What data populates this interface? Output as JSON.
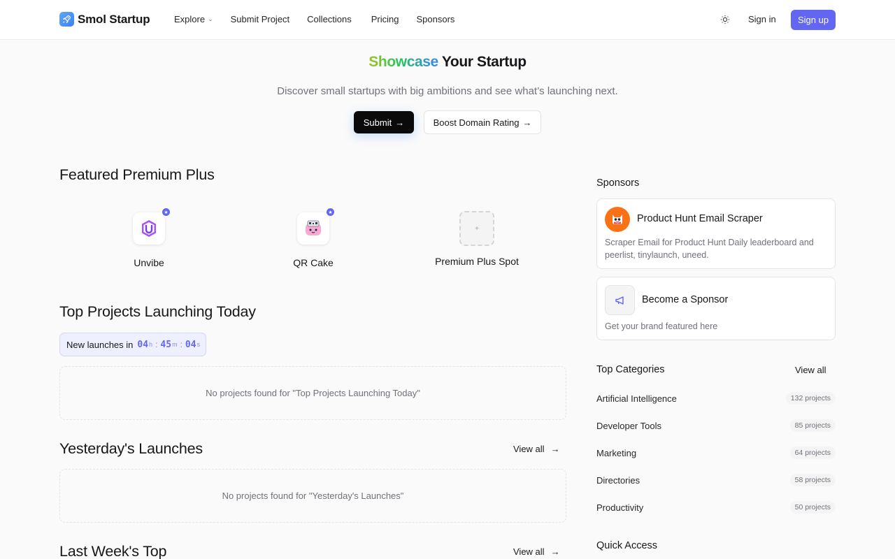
{
  "brand": {
    "name": "Smol Startup",
    "icon": "rocket-icon"
  },
  "nav": {
    "explore": "Explore",
    "submit_project": "Submit Project",
    "collections": "Collections",
    "pricing": "Pricing",
    "sponsors": "Sponsors"
  },
  "auth": {
    "sign_in": "Sign in",
    "sign_up": "Sign up"
  },
  "hero": {
    "title_highlight": "Showcase",
    "title_rest": " Your Startup",
    "subtitle": "Discover small startups with big ambitions and see what’s launching next.",
    "submit_label": "Submit",
    "boost_label": "Boost Domain Rating"
  },
  "featured": {
    "title": "Featured Premium Plus",
    "items": [
      {
        "name": "Unvibe",
        "icon": "unvibe-logo-icon"
      },
      {
        "name": "QR Cake",
        "icon": "qr-cake-logo-icon"
      },
      {
        "name": "Premium Plus Spot",
        "icon": "plus-icon",
        "placeholder_symbol": "+"
      }
    ]
  },
  "today": {
    "title": "Top Projects Launching Today",
    "countdown_label": "New launches in",
    "hours": "04",
    "minutes": "45",
    "seconds": "04",
    "unit_h": "h",
    "unit_m": "m",
    "unit_s": "s",
    "empty": "No projects found for \"Top Projects Launching Today\""
  },
  "yesterday": {
    "title": "Yesterday's Launches",
    "view_all": "View all",
    "empty": "No projects found for \"Yesterday's Launches\""
  },
  "last_week": {
    "title": "Last Week's Top",
    "view_all": "View all"
  },
  "sponsors": {
    "title": "Sponsors",
    "cards": [
      {
        "name": "Product Hunt Email Scraper",
        "description": "Scraper Email for Product Hunt Daily leaderboard and peerlist, tinylaunch, uneed.",
        "icon": "cat-mascot-icon"
      },
      {
        "name": "Become a Sponsor",
        "description": "Get your brand featured here",
        "icon": "megaphone-icon"
      }
    ]
  },
  "categories": {
    "title": "Top Categories",
    "view_all": "View all",
    "items": [
      {
        "name": "Artificial Intelligence",
        "count": "132 projects"
      },
      {
        "name": "Developer Tools",
        "count": "85 projects"
      },
      {
        "name": "Marketing",
        "count": "64 projects"
      },
      {
        "name": "Directories",
        "count": "58 projects"
      },
      {
        "name": "Productivity",
        "count": "50 projects"
      }
    ]
  },
  "quick_access": {
    "title": "Quick Access"
  },
  "colors": {
    "accent": "#6366f1",
    "ink": "#18181b",
    "muted": "#71717a"
  }
}
